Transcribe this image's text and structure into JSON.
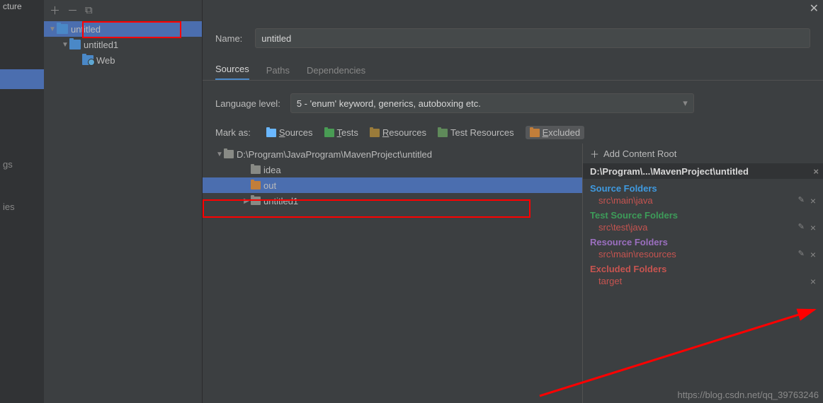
{
  "leftstrip": {
    "title_fragment": "cture",
    "items": [
      "",
      "",
      "gs",
      "",
      "ies"
    ]
  },
  "tree_toolbar": {
    "add": "＋",
    "remove": "－",
    "copy": "⧉"
  },
  "modules": [
    {
      "name": "untitled",
      "indent": 0,
      "selected": true,
      "arrow": "open"
    },
    {
      "name": "untitled1",
      "indent": 1,
      "arrow": "open"
    },
    {
      "name": "Web",
      "indent": 2,
      "arrow": "",
      "icon": "web"
    }
  ],
  "name_label": "Name:",
  "name_value": "untitled",
  "tabs": {
    "sources": "Sources",
    "paths": "Paths",
    "deps": "Dependencies"
  },
  "lang_label": "Language level:",
  "lang_value": "5 - 'enum' keyword, generics, autoboxing etc.",
  "mark_label": "Mark as:",
  "marks": {
    "sources": "Sources",
    "tests": "Tests",
    "resources": "Resources",
    "test_resources": "Test Resources",
    "excluded": "Excluded"
  },
  "folder_root": "D:\\Program\\JavaProgram\\MavenProject\\untitled",
  "folders": [
    {
      "name": "idea",
      "indent": 1,
      "arrow": "",
      "color": "plain"
    },
    {
      "name": "out",
      "indent": 1,
      "arrow": "",
      "color": "orange",
      "selected": true,
      "highlight": true
    },
    {
      "name": "untitled1",
      "indent": 1,
      "arrow": "closed",
      "color": "plain"
    }
  ],
  "croot_header": "Add Content Root",
  "croot_path": "D:\\Program\\...\\MavenProject\\untitled",
  "sections": [
    {
      "title": "Source Folders",
      "class": "blue",
      "items": [
        "src\\main\\java"
      ],
      "tools": true
    },
    {
      "title": "Test Source Folders",
      "class": "green",
      "items": [
        "src\\test\\java"
      ],
      "tools": true
    },
    {
      "title": "Resource Folders",
      "class": "purple",
      "items": [
        "src\\main\\resources"
      ],
      "tools": true
    },
    {
      "title": "Excluded Folders",
      "class": "red",
      "items": [
        "target"
      ],
      "tools_x_only": true
    }
  ],
  "close_x": "✕",
  "watermark": "https://blog.csdn.net/qq_39763246"
}
